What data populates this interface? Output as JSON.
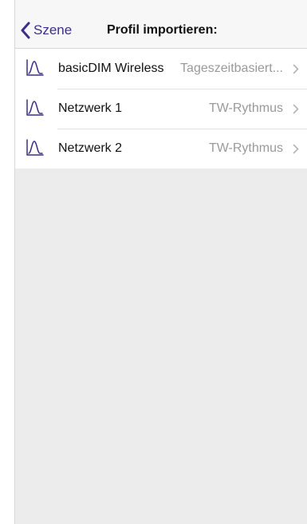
{
  "navbar": {
    "back_label": "Szene",
    "back_icon": "chevron-left-icon",
    "title": "Profil importieren:"
  },
  "colors": {
    "accent": "#3c2f88",
    "navbar_background": "#f7f7f7",
    "list_background": "#ffffff",
    "empty_background": "#ececec",
    "detail_text": "#9a9a9a",
    "separator": "#e2e2e2"
  },
  "profiles": [
    {
      "icon": "profile-curve-icon",
      "name": "basicDIM Wireless",
      "detail": "Tageszeitbasiert...",
      "disclosure_icon": "chevron-right-icon"
    },
    {
      "icon": "profile-curve-icon",
      "name": "Netzwerk 1",
      "detail": "TW-Rythmus",
      "disclosure_icon": "chevron-right-icon"
    },
    {
      "icon": "profile-curve-icon",
      "name": "Netzwerk 2",
      "detail": "TW-Rythmus",
      "disclosure_icon": "chevron-right-icon"
    }
  ]
}
